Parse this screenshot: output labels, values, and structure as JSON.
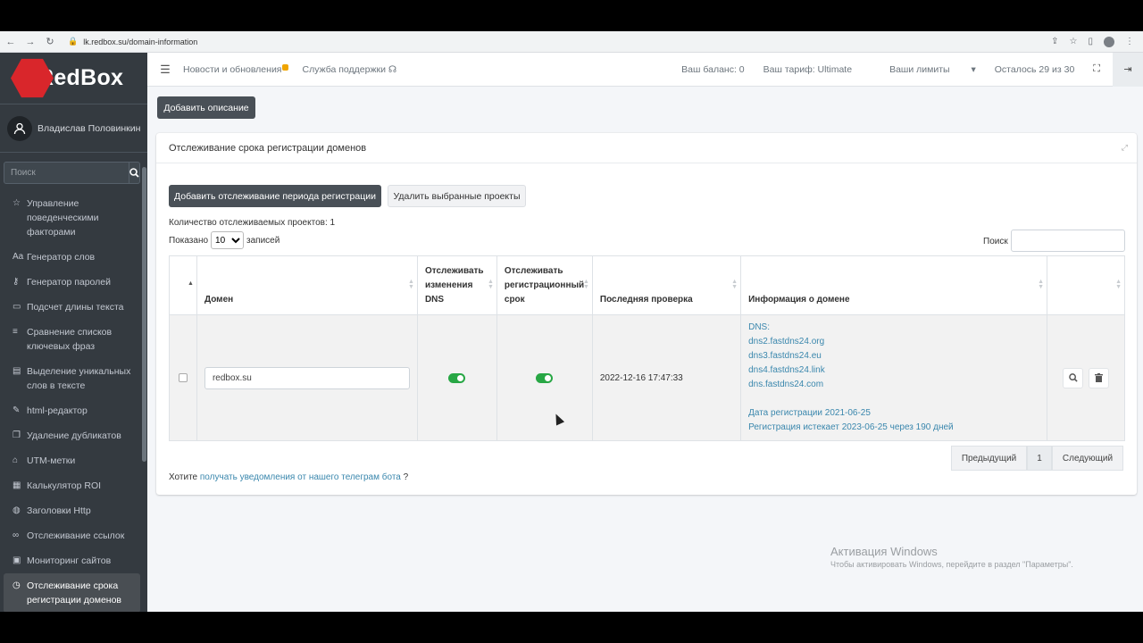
{
  "browser": {
    "url": "lk.redbox.su/domain-information"
  },
  "brand": {
    "name": "RedBox"
  },
  "user": {
    "name": "Владислав Половинкин"
  },
  "sidebar": {
    "search_placeholder": "Поиск",
    "items": [
      {
        "label": "Управление поведенческими факторами",
        "icon": "star-icon"
      },
      {
        "label": "Генератор слов",
        "icon": "text-aa-icon"
      },
      {
        "label": "Генератор паролей",
        "icon": "key-icon"
      },
      {
        "label": "Подсчет длины текста",
        "icon": "document-icon"
      },
      {
        "label": "Сравнение списков ключевых фраз",
        "icon": "list-icon"
      },
      {
        "label": "Выделение уникальных слов в тексте",
        "icon": "file-text-icon"
      },
      {
        "label": "html-редактор",
        "icon": "edit-icon"
      },
      {
        "label": "Удаление дубликатов",
        "icon": "copy-icon"
      },
      {
        "label": "UTM-метки",
        "icon": "tag-icon"
      },
      {
        "label": "Калькулятор ROI",
        "icon": "calculator-icon"
      },
      {
        "label": "Заголовки Http",
        "icon": "globe-icon"
      },
      {
        "label": "Отслеживание ссылок",
        "icon": "link-icon"
      },
      {
        "label": "Мониторинг сайтов",
        "icon": "monitor-icon"
      },
      {
        "label": "Отслеживание срока регистрации доменов",
        "icon": "clock-icon"
      }
    ]
  },
  "navbar": {
    "news": "Новости и обновления",
    "support": "Служба поддержки",
    "balance": "Ваш баланс: 0",
    "tariff": "Ваш тариф: Ultimate",
    "limits": "Ваши лимиты",
    "remaining": "Осталось 29 из 30"
  },
  "page": {
    "add_description": "Добавить описание",
    "card_title": "Отслеживание срока регистрации доменов",
    "add_tracking": "Добавить отслеживание периода регистрации",
    "delete_selected": "Удалить выбранные проекты",
    "count_label": "Количество отслеживаемых проектов: 1",
    "shown_prefix": "Показано",
    "shown_value": "10",
    "shown_suffix": "записей",
    "search_label": "Поиск"
  },
  "table": {
    "headers": {
      "domain": "Домен",
      "dns_line1": "Отслеживать",
      "dns_line2": "изменения",
      "dns_line3": "DNS",
      "reg_line1": "Отслеживать",
      "reg_line2": "регистрационный",
      "reg_line3": "срок",
      "last_check": "Последняя проверка",
      "info": "Информация о домене"
    },
    "row": {
      "domain": "redbox.su",
      "dns_tracking": true,
      "reg_tracking": true,
      "last_check": "2022-12-16 17:47:33",
      "dns_label": "DNS:",
      "dns_list": [
        "dns2.fastdns24.org",
        "dns3.fastdns24.eu",
        "dns4.fastdns24.link",
        "dns.fastdns24.com"
      ],
      "reg_date": "Дата регистрации  2021-06-25",
      "expires": "Регистрация истекает 2023-06-25 через 190 дней"
    }
  },
  "pager": {
    "prev": "Предыдущий",
    "page": "1",
    "next": "Следующий"
  },
  "telegram": {
    "prefix": "Хотите",
    "link": "получать уведомления от нашего телеграм бота",
    "suffix": "?"
  },
  "watermark": {
    "title": "Активация Windows",
    "subtitle": "Чтобы активировать Windows, перейдите в раздел \"Параметры\"."
  },
  "colors": {
    "accent_green": "#28a745",
    "sidebar": "#343a40",
    "brand_red": "#d9262b",
    "link": "#3a87ad"
  }
}
